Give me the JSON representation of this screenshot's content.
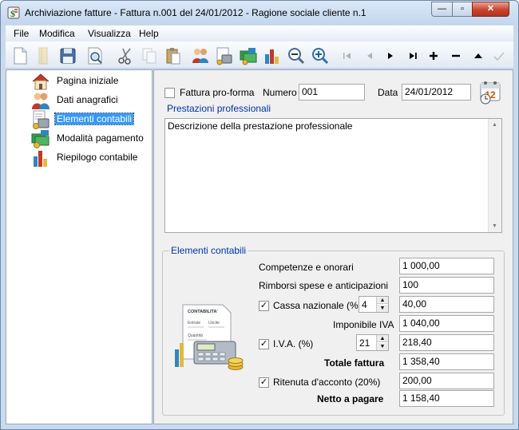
{
  "window": {
    "title": "Archiviazione fatture  -  Fattura n.001 del 24/01/2012  -  Ragione sociale cliente n.1",
    "minimize": "—",
    "maximize": "▫",
    "close": "✕"
  },
  "menu": {
    "items": [
      "File",
      "Modifica",
      "Visualizza",
      "Help"
    ]
  },
  "toolbar": {
    "buttons": [
      {
        "icon": "new-document-icon",
        "enabled": true
      },
      {
        "icon": "open-folder-icon",
        "enabled": false
      },
      {
        "icon": "save-icon",
        "enabled": true
      },
      {
        "icon": "print-preview-icon",
        "enabled": true
      },
      {
        "icon": "cut-icon",
        "enabled": true
      },
      {
        "icon": "copy-icon",
        "enabled": false
      },
      {
        "icon": "paste-icon",
        "enabled": true
      },
      {
        "icon": "people-icon",
        "enabled": true
      },
      {
        "icon": "accounting-icon",
        "enabled": true
      },
      {
        "icon": "payment-icon",
        "enabled": true
      },
      {
        "icon": "bar-chart-icon",
        "enabled": true
      },
      {
        "icon": "zoom-out-icon",
        "enabled": true
      },
      {
        "icon": "zoom-in-icon",
        "enabled": true
      },
      {
        "icon": "first-record-icon",
        "enabled": false
      },
      {
        "icon": "previous-record-icon",
        "enabled": false
      },
      {
        "icon": "next-record-icon",
        "enabled": true
      },
      {
        "icon": "last-record-icon",
        "enabled": true
      },
      {
        "icon": "add-record-icon",
        "enabled": true
      },
      {
        "icon": "delete-record-icon",
        "enabled": true
      },
      {
        "icon": "edit-record-icon",
        "enabled": true
      },
      {
        "icon": "confirm-icon",
        "enabled": false
      }
    ]
  },
  "nav": {
    "items": [
      {
        "label": "Pagina iniziale",
        "icon": "home-icon",
        "selected": false
      },
      {
        "label": "Dati anagrafici",
        "icon": "people-icon",
        "selected": false
      },
      {
        "label": "Elementi contabili",
        "icon": "accounting-icon",
        "selected": true
      },
      {
        "label": "Modalità pagamento",
        "icon": "payment-icon",
        "selected": false
      },
      {
        "label": "Riepilogo contabile",
        "icon": "bar-chart-icon",
        "selected": false
      }
    ]
  },
  "form": {
    "proforma_label": "Fattura pro-forma",
    "proforma_checked": false,
    "numero_label": "Numero",
    "numero_value": "001",
    "data_label": "Data",
    "data_value": "24/01/2012",
    "calendar_day": "12",
    "prestazioni_label": "Prestazioni professionali",
    "prestazioni_text": "Descrizione della prestazione professionale"
  },
  "elementi": {
    "group_title": "Elementi contabili",
    "competenze_label": "Competenze e onorari",
    "competenze_value": "1 000,00",
    "rimborsi_label": "Rimborsi spese e anticipazioni",
    "rimborsi_value": "100",
    "cassa_label": "Cassa nazionale (%)",
    "cassa_checked": true,
    "cassa_pct": "4",
    "cassa_value": "40,00",
    "imponibile_label": "Imponibile IVA",
    "imponibile_value": "1 040,00",
    "iva_label": "I.V.A. (%)",
    "iva_checked": true,
    "iva_pct": "21",
    "iva_value": "218,40",
    "totale_label": "Totale fattura",
    "totale_value": "1 358,40",
    "ritenuta_label": "Ritenuta d'acconto (20%)",
    "ritenuta_checked": true,
    "ritenuta_value": "200,00",
    "netto_label": "Netto a pagare",
    "netto_value": "1 158,40",
    "check_mark": "✓",
    "illustration_doc_title": "CONTABILITA'",
    "illustration_doc_col1": "Entrate",
    "illustration_doc_col2": "Uscite",
    "illustration_doc_row": "Quantità"
  }
}
